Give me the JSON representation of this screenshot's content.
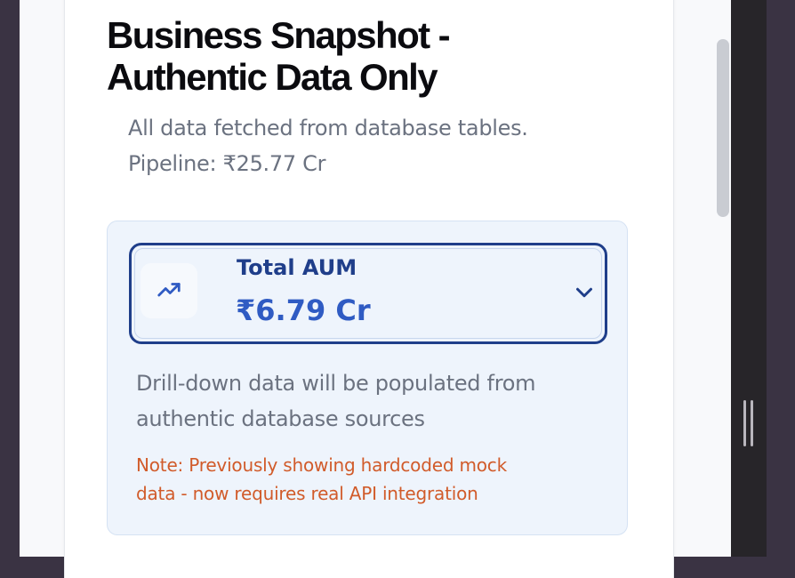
{
  "page": {
    "title_line1": "Business Snapshot -",
    "title_line2": "Authentic Data Only",
    "subtitle_line1": "All data fetched from database tables.",
    "subtitle_line2": "Pipeline: ₹25.77 Cr"
  },
  "metric": {
    "label": "Total AUM",
    "value": "₹6.79 Cr",
    "icon": "trending-up-icon",
    "toggle_icon": "chevron-down-icon",
    "expanded": false
  },
  "drilldown": {
    "message_line1": "Drill-down data will be populated from",
    "message_line2": "authentic database sources",
    "note_line1": "Note: Previously showing hardcoded mock",
    "note_line2": "data - now requires real API integration"
  },
  "colors": {
    "accent_dark": "#1f3e8a",
    "accent_value": "#2f5bc3",
    "panel_bg": "#eef4fc",
    "note": "#d15b2a",
    "muted_text": "#6b7280"
  }
}
